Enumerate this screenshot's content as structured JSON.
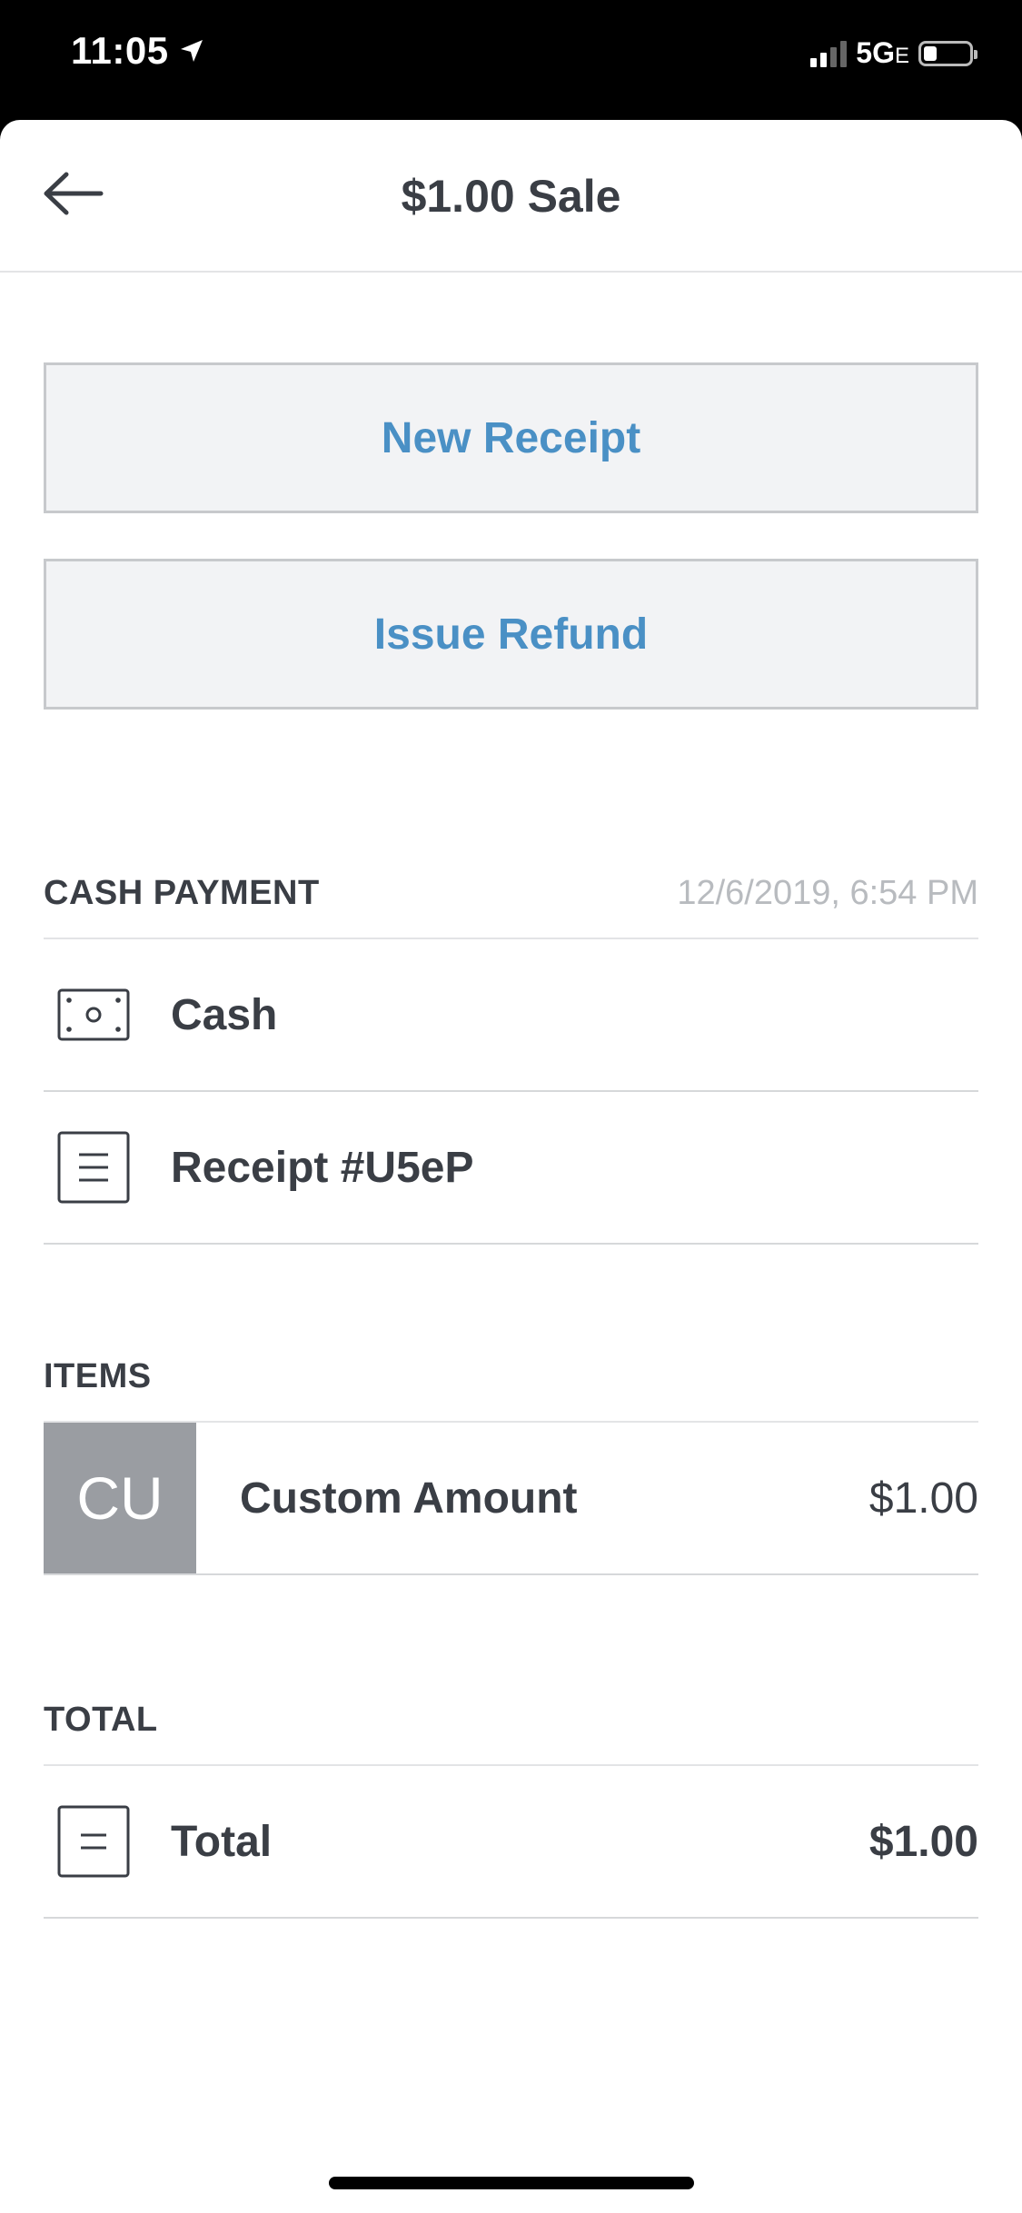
{
  "status_bar": {
    "time": "11:05",
    "network": "5G",
    "network_suffix": "E",
    "signal_strength_bars": 2,
    "battery_level": 0.2
  },
  "nav": {
    "title": "$1.00 Sale",
    "back_icon": "arrow-left-icon"
  },
  "actions": {
    "new_receipt": "New Receipt",
    "issue_refund": "Issue Refund"
  },
  "payment": {
    "section_title": "CASH PAYMENT",
    "timestamp": "12/6/2019, 6:54 PM",
    "method_label": "Cash",
    "method_icon": "cash-icon",
    "receipt_label": "Receipt #U5eP",
    "receipt_icon": "receipt-icon"
  },
  "items": {
    "section_title": "ITEMS",
    "list": [
      {
        "thumb": "CU",
        "name": "Custom Amount",
        "price": "$1.00"
      }
    ]
  },
  "total": {
    "section_title": "TOTAL",
    "label": "Total",
    "amount": "$1.00",
    "icon": "total-icon"
  },
  "colors": {
    "accent": "#4a90c5",
    "text": "#3a3e45",
    "muted": "#b8bbbf",
    "button_bg": "#f2f3f5",
    "thumb_bg": "#9a9da2"
  }
}
